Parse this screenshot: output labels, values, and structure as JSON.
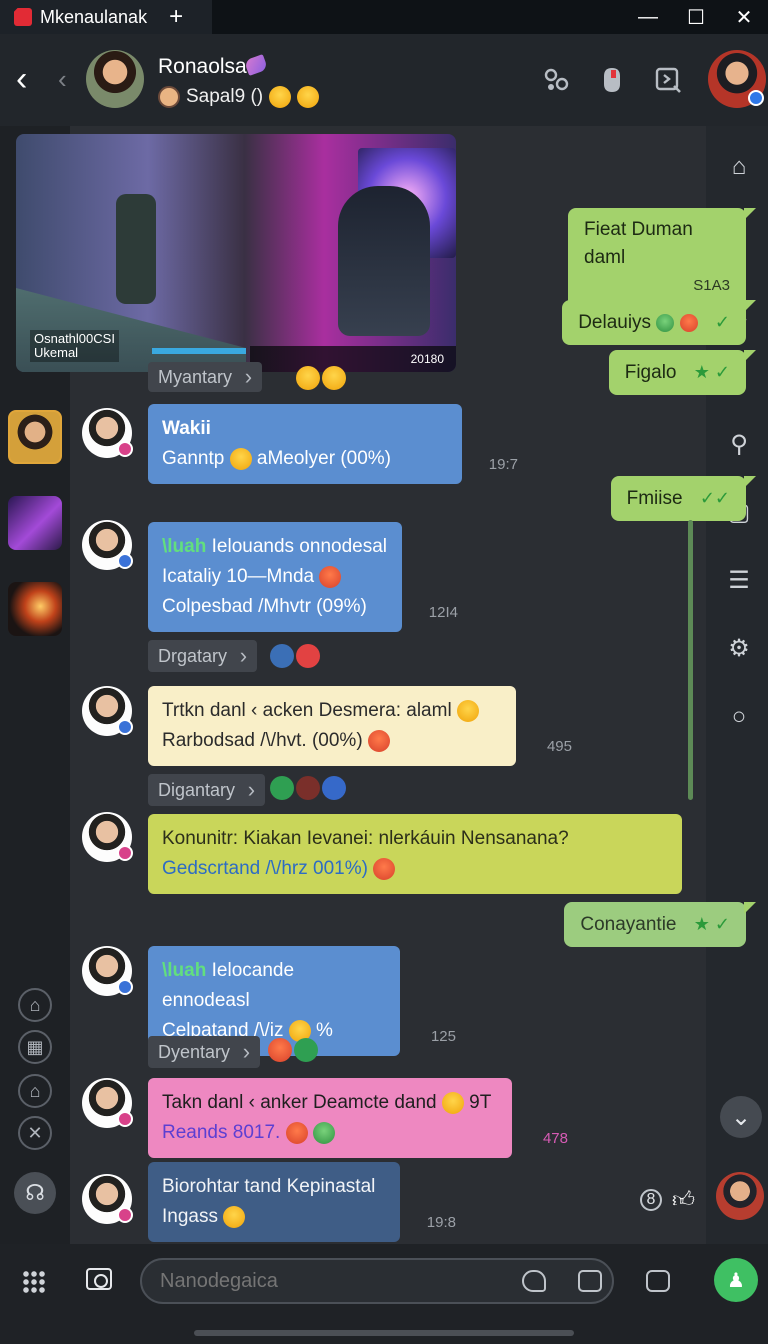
{
  "window": {
    "tab_title": "Mkenaulanak",
    "tab_add": "+",
    "controls": [
      "—",
      "☐",
      "✕"
    ]
  },
  "header": {
    "name": "Ronaolsa",
    "status": "Sapal9 ()"
  },
  "media": {
    "overlay_line1": "Osnathl00CSI",
    "overlay_line2": "Ukemal",
    "corner_label": "20180"
  },
  "chips": [
    {
      "label": "Myantary"
    },
    {
      "label": "Drgatary"
    },
    {
      "label": "Digantary"
    },
    {
      "label": "Dyentary"
    }
  ],
  "outgoing": [
    {
      "text": "Fieat Duman daml",
      "time": "S1A3"
    },
    {
      "text": "Delauiys",
      "tick": "✓"
    },
    {
      "text": "Figalo",
      "tick": "★ ✓"
    },
    {
      "text": "Fmiise",
      "tick": "✓✓"
    },
    {
      "text": "Conayantie",
      "tick": "★ ✓"
    }
  ],
  "messages": [
    {
      "title": "Wakii",
      "line": "Ganntp",
      "line_b": "aMeolyer (00%)",
      "time": "19:7"
    },
    {
      "tag": "\\luah",
      "line1": "Ielouands onnodesal",
      "line2": "Icataliy 10—Mnda",
      "line3": "Colpesbad /Mhvtr (09%)",
      "time": "12I4"
    },
    {
      "line1": "Trtkn danl ‹ acken Desmera: alaml",
      "line2": "Rarbodsad /\\/hvt. (00%)",
      "time": "495"
    },
    {
      "line1": "Konunitr: Kiakan Ievanei: nlerkáuin Nensanana?",
      "line2": "Gedscrtand /\\/hrz 001%)",
      "time": ""
    },
    {
      "tag": "\\luah",
      "line1": "Ielocande ennodeasl",
      "line2": "Celpatand /\\/iz",
      "line2b": "%",
      "time": "125"
    },
    {
      "line1": "Takn danl ‹ anker Deamcte dand",
      "line1b": "9T",
      "line2": "Reands 8017.",
      "time": "478"
    },
    {
      "line1": "Biorohtar tand Kepinastal",
      "line2": "Ingass",
      "time": "19:8"
    }
  ],
  "right_badge": "8",
  "composer": {
    "placeholder": "Nanodegaica"
  },
  "colors": {
    "accent_green": "#3fc063",
    "bubble_blue": "#5b8ed0",
    "bubble_out": "#a3d26c"
  }
}
